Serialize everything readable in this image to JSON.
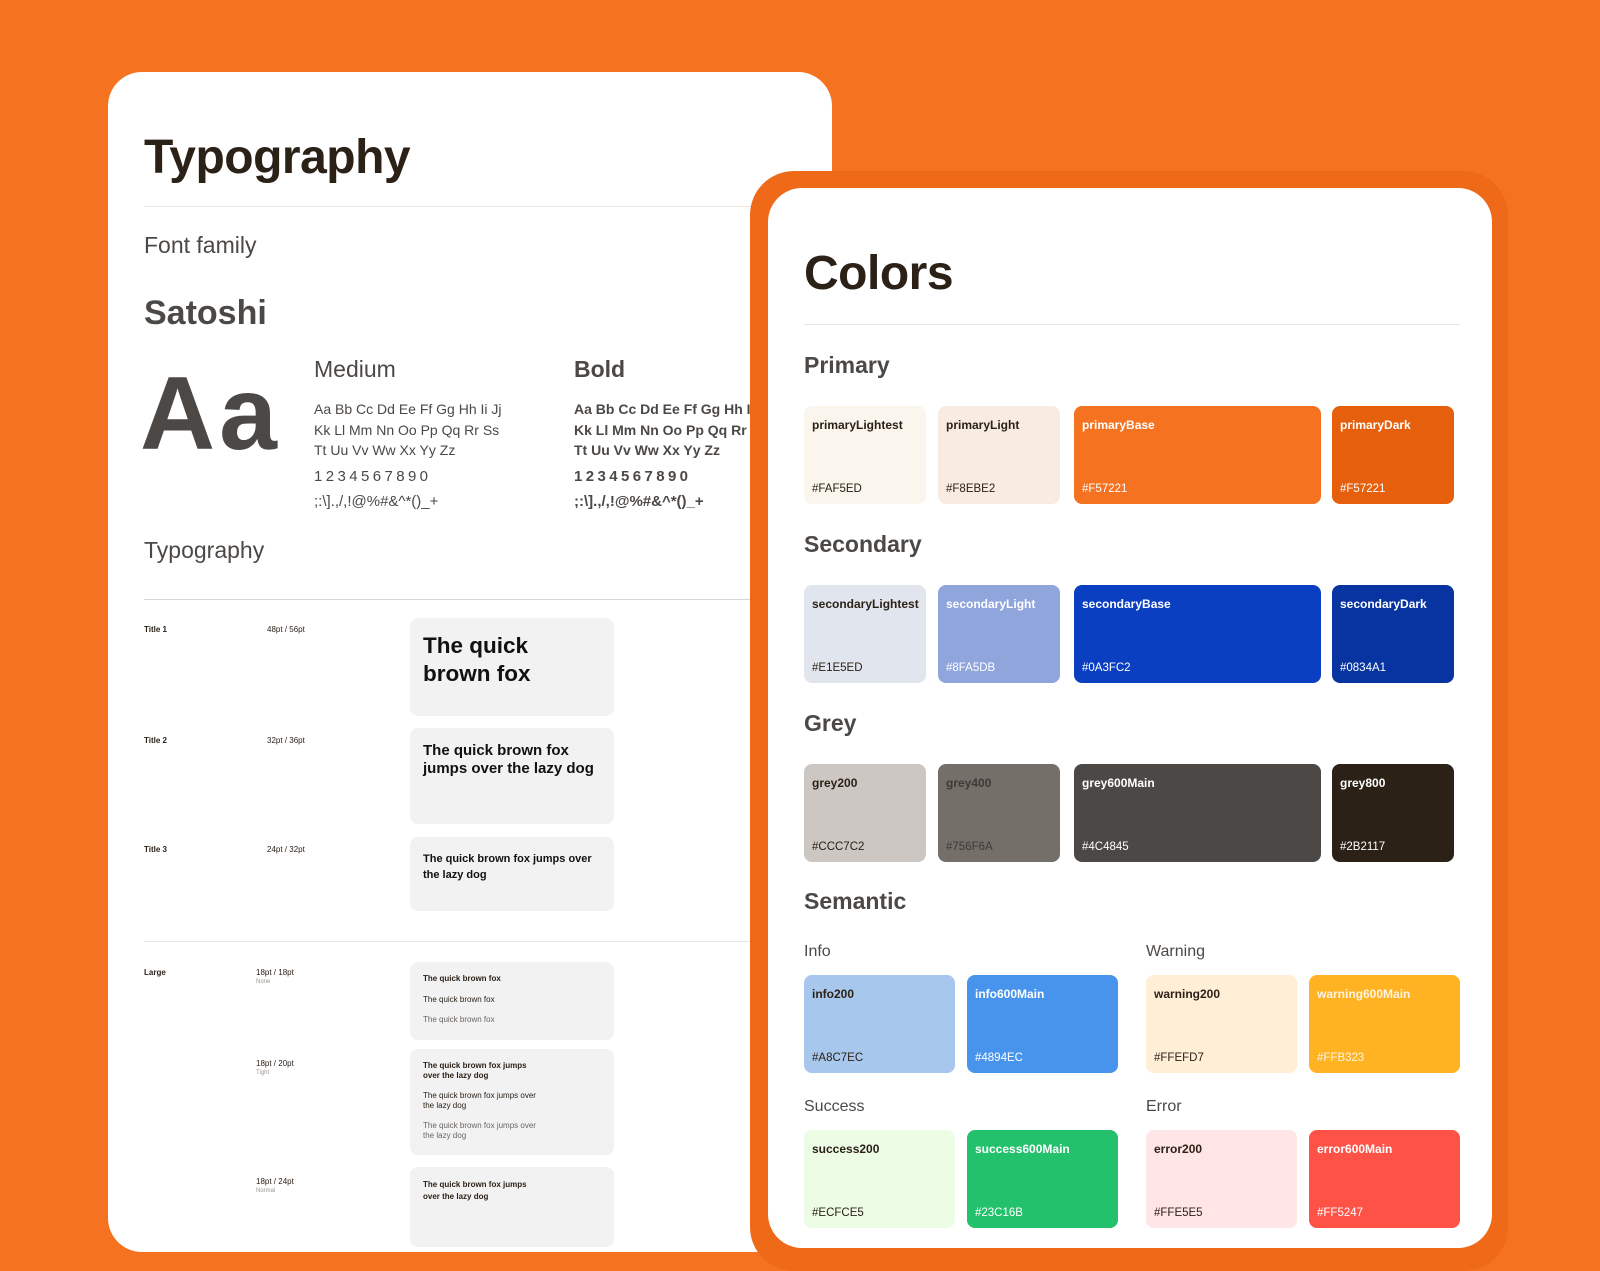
{
  "typography_card": {
    "title": "Typography",
    "font_family_heading": "Font family",
    "family_name": "Satoshi",
    "specimen": "Aa",
    "weights": [
      {
        "name": "Medium",
        "lines": [
          "Aa Bb Cc Dd Ee Ff Gg Hh Ii Jj",
          "Kk Ll Mm Nn Oo Pp Qq Rr Ss",
          "Tt Uu Vv Ww Xx Yy Zz"
        ],
        "numbers": "1234567890",
        "symbols": ";:\\].,/,!@%#&^*()_+"
      },
      {
        "name": "Bold",
        "lines": [
          "Aa Bb Cc Dd Ee Ff Gg Hh Ii Jj",
          "Kk Ll Mm Nn Oo Pp Qq Rr Ss",
          "Tt Uu Vv Ww Xx Yy Zz"
        ],
        "numbers": "1234567890",
        "symbols": ";:\\].,/,!@%#&^*()_+"
      }
    ],
    "typography_heading": "Typography",
    "titles": [
      {
        "label": "Title 1",
        "size": "48pt / 56pt",
        "sample": "The quick brown fox"
      },
      {
        "label": "Title 2",
        "size": "32pt / 36pt",
        "sample": "The quick brown fox jumps over the lazy dog"
      },
      {
        "label": "Title 3",
        "size": "24pt / 32pt",
        "sample": "The quick brown fox jumps over the lazy dog"
      }
    ],
    "large": {
      "label": "Large",
      "groups": [
        {
          "size": "18pt / 18pt",
          "note": "None",
          "samples": [
            "The quick brown fox",
            "The quick brown fox",
            "The quick brown fox"
          ]
        },
        {
          "size": "18pt / 20pt",
          "note": "Tight",
          "samples": [
            "The quick brown fox jumps over the lazy dog",
            "The quick brown fox jumps over the lazy dog",
            "The quick brown fox jumps over the lazy dog"
          ]
        },
        {
          "size": "18pt / 24pt",
          "note": "Normal",
          "samples": [
            "The quick brown fox jumps over the lazy dog"
          ]
        }
      ]
    }
  },
  "colors_card": {
    "title": "Colors",
    "sections": [
      {
        "name": "Primary",
        "swatches": [
          {
            "name": "primaryLightest",
            "hex": "#FAF5ED",
            "color": "#FAF5ED",
            "text": "#2B2117"
          },
          {
            "name": "primaryLight",
            "hex": "#F8EBE2",
            "color": "#F8EBE2",
            "text": "#2B2117"
          },
          {
            "name": "primaryBase",
            "hex": "#F57221",
            "color": "#F57221",
            "text": "#FFFFFF"
          },
          {
            "name": "primaryDark",
            "hex": "#F57221",
            "color": "#E65F0C",
            "text": "#FFFFFF"
          }
        ]
      },
      {
        "name": "Secondary",
        "swatches": [
          {
            "name": "secondaryLightest",
            "hex": "#E1E5ED",
            "color": "#E1E5ED",
            "text": "#2B2117"
          },
          {
            "name": "secondaryLight",
            "hex": "#8FA5DB",
            "color": "#8FA5DB",
            "text": "#FFFFFF"
          },
          {
            "name": "secondaryBase",
            "hex": "#0A3FC2",
            "color": "#0A3FC2",
            "text": "#FFFFFF"
          },
          {
            "name": "secondaryDark",
            "hex": "#0834A1",
            "color": "#0834A1",
            "text": "#FFFFFF"
          }
        ]
      },
      {
        "name": "Grey",
        "swatches": [
          {
            "name": "grey200",
            "hex": "#CCC7C2",
            "color": "#CCC7C2",
            "text": "#2B2117"
          },
          {
            "name": "grey400",
            "hex": "#756F6A",
            "color": "#756F6A",
            "text": "#3F3A36"
          },
          {
            "name": "grey600Main",
            "hex": "#4C4845",
            "color": "#4C4845",
            "text": "#FFFFFF"
          },
          {
            "name": "grey800",
            "hex": "#2B2117",
            "color": "#2B2117",
            "text": "#FFFFFF"
          }
        ]
      }
    ],
    "semantic_heading": "Semantic",
    "semantic": [
      {
        "name": "Info",
        "swatches": [
          {
            "name": "info200",
            "hex": "#A8C7EC",
            "color": "#A8C7EC",
            "text": "#2B2117"
          },
          {
            "name": "info600Main",
            "hex": "#4894EC",
            "color": "#4894EC",
            "text": "#FFFFFF"
          }
        ]
      },
      {
        "name": "Warning",
        "swatches": [
          {
            "name": "warning200",
            "hex": "#FFEFD7",
            "color": "#FFEFD7",
            "text": "#2B2117"
          },
          {
            "name": "warning600Main",
            "hex": "#FFB323",
            "color": "#FFB323",
            "text": "#FFF4E0"
          }
        ]
      },
      {
        "name": "Success",
        "swatches": [
          {
            "name": "success200",
            "hex": "#ECFCE5",
            "color": "#ECFCE5",
            "text": "#2B2117"
          },
          {
            "name": "success600Main",
            "hex": "#23C16B",
            "color": "#23C16B",
            "text": "#FFFFFF"
          }
        ]
      },
      {
        "name": "Error",
        "swatches": [
          {
            "name": "error200",
            "hex": "#FFE5E5",
            "color": "#FFE5E5",
            "text": "#2B2117"
          },
          {
            "name": "error600Main",
            "hex": "#FF5247",
            "color": "#FF5247",
            "text": "#FFFFFF"
          }
        ]
      }
    ]
  }
}
